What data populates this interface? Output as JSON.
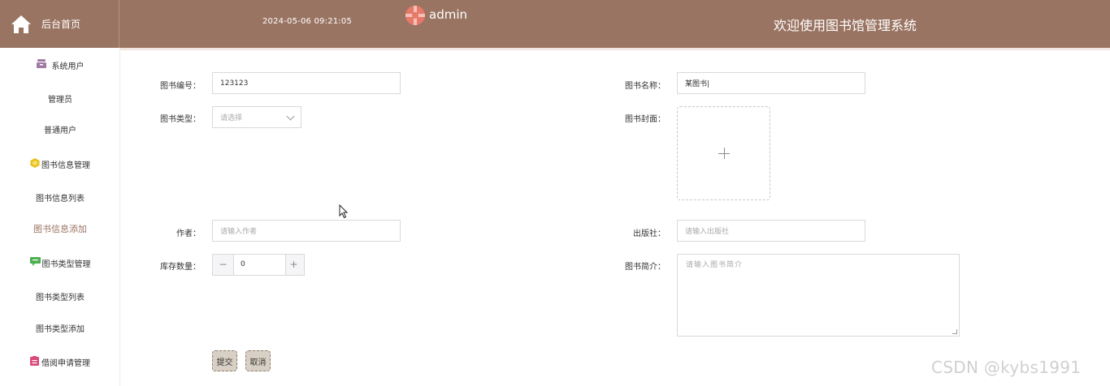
{
  "header": {
    "home_label": "后台首页",
    "datetime": "2024-05-06 09:21:05",
    "username": "admin",
    "welcome": "欢迎使用图书馆管理系统",
    "bg_color": "#9a7462"
  },
  "sidebar": {
    "items": [
      {
        "label": "系统用户",
        "icon": "user-group-icon",
        "type": "group"
      },
      {
        "label": "管理员",
        "type": "item"
      },
      {
        "label": "普通用户",
        "type": "item"
      },
      {
        "label": "图书信息管理",
        "icon": "book-info-icon",
        "type": "group"
      },
      {
        "label": "图书信息列表",
        "type": "item"
      },
      {
        "label": "图书信息添加",
        "type": "item",
        "active": true
      },
      {
        "label": "图书类型管理",
        "icon": "book-type-icon",
        "type": "group"
      },
      {
        "label": "图书类型列表",
        "type": "item"
      },
      {
        "label": "图书类型添加",
        "type": "item"
      },
      {
        "label": "借阅申请管理",
        "icon": "borrow-icon",
        "type": "group"
      }
    ]
  },
  "form": {
    "book_no_label": "图书编号：",
    "book_no_value": "123123",
    "book_name_label": "图书名称：",
    "book_name_value": "某图书|",
    "book_type_label": "图书类型：",
    "book_type_placeholder": "请选择",
    "cover_label": "图书封面：",
    "author_label": "作者：",
    "author_placeholder": "请输入作者",
    "publisher_label": "出版社：",
    "publisher_placeholder": "请输入出版社",
    "stock_label": "库存数量：",
    "stock_value": "0",
    "stock_minus": "−",
    "stock_plus": "+",
    "intro_label": "图书简介：",
    "intro_placeholder": "请输入图书简介",
    "submit_label": "提交",
    "cancel_label": "取消"
  },
  "watermark": "CSDN @kybs1991"
}
